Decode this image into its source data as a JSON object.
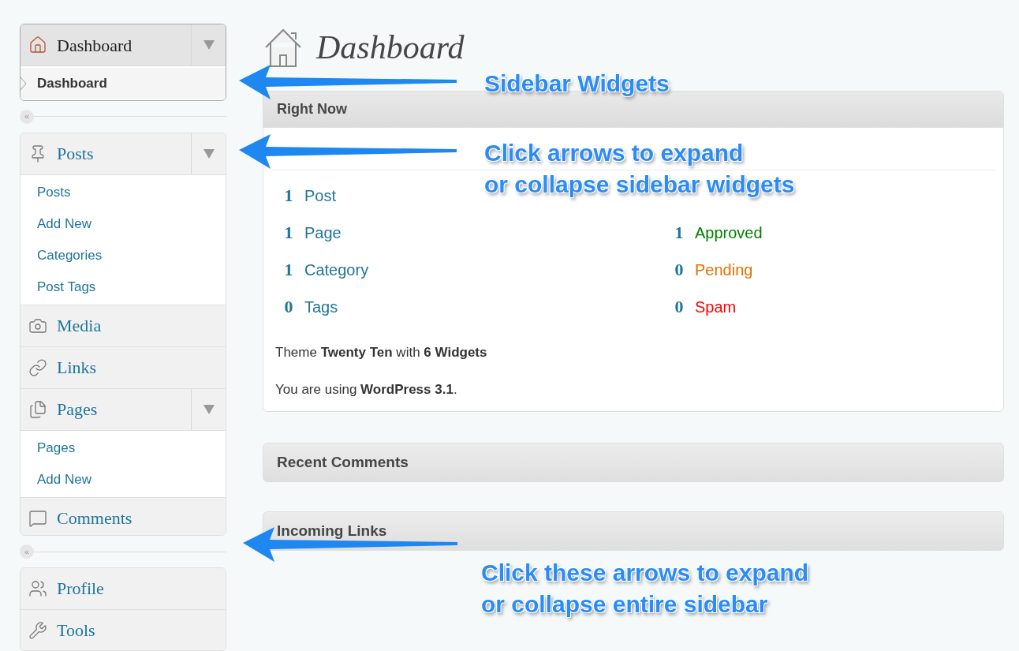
{
  "sidebar": {
    "groups": [
      {
        "items": [
          {
            "label": "Dashboard",
            "selected": true,
            "expanded": true,
            "submenu": [
              {
                "label": "Dashboard",
                "selected": true
              }
            ]
          }
        ]
      },
      {
        "items": [
          {
            "label": "Posts",
            "selected": false,
            "expanded": true,
            "submenu": [
              {
                "label": "Posts",
                "selected": false
              },
              {
                "label": "Add New",
                "selected": false
              },
              {
                "label": "Categories",
                "selected": false
              },
              {
                "label": "Post Tags",
                "selected": false
              }
            ]
          },
          {
            "label": "Media",
            "selected": false
          },
          {
            "label": "Links",
            "selected": false
          },
          {
            "label": "Pages",
            "selected": false,
            "expanded": true,
            "submenu": [
              {
                "label": "Pages",
                "selected": false
              },
              {
                "label": "Add New",
                "selected": false
              }
            ]
          },
          {
            "label": "Comments",
            "selected": false
          }
        ]
      },
      {
        "items": [
          {
            "label": "Profile",
            "selected": false
          },
          {
            "label": "Tools",
            "selected": false
          }
        ]
      }
    ],
    "collapse_buttons": [
      "«",
      "«"
    ]
  },
  "page_title": "Dashboard",
  "right_now": {
    "title": "Right Now",
    "rows": [
      {
        "left": {
          "count": "1",
          "label": "Post"
        }
      },
      {
        "left": {
          "count": "1",
          "label": "Page"
        },
        "right": {
          "count": "1",
          "label": "Approved",
          "color": "#008000"
        }
      },
      {
        "left": {
          "count": "1",
          "label": "Category"
        },
        "right": {
          "count": "0",
          "label": "Pending",
          "color": "#e66f00"
        }
      },
      {
        "left": {
          "count": "0",
          "label": "Tags"
        },
        "right": {
          "count": "0",
          "label": "Spam",
          "color": "#ff0000"
        }
      }
    ],
    "theme_line": "Theme **Twenty Ten** with **6 Widgets**",
    "version_line": "You are using **WordPress 3.1**."
  },
  "widgets": [
    {
      "title": "Recent Comments"
    },
    {
      "title": "Incoming Links"
    }
  ],
  "annotations": [
    {
      "lines": [
        "Sidebar Widgets"
      ]
    },
    {
      "lines": [
        "Click arrows to expand",
        "or collapse sidebar widgets"
      ]
    },
    {
      "lines": [
        "Click these arrows to expand",
        "or collapse entire sidebar"
      ]
    }
  ]
}
